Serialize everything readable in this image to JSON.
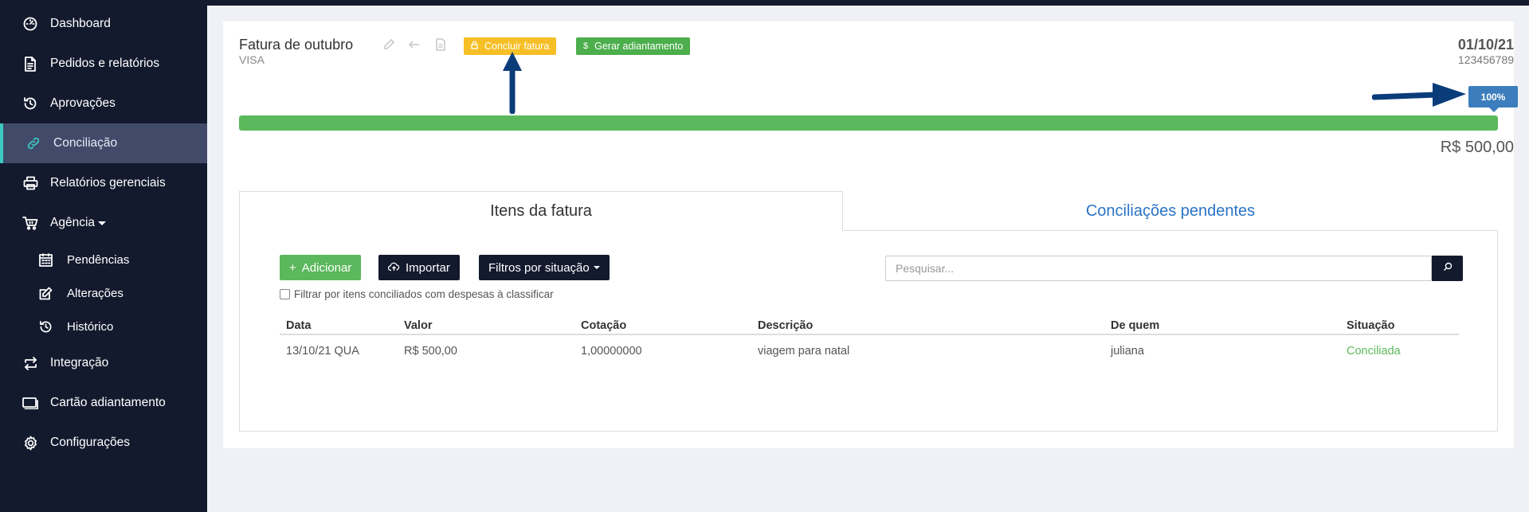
{
  "sidebar": {
    "items": [
      {
        "label": "Dashboard",
        "icon": "dashboard-icon"
      },
      {
        "label": "Pedidos e relatórios",
        "icon": "document-icon"
      },
      {
        "label": "Aprovações",
        "icon": "history-icon"
      },
      {
        "label": "Conciliação",
        "icon": "link-icon",
        "active": true
      },
      {
        "label": "Relatórios gerenciais",
        "icon": "printer-icon"
      },
      {
        "label": "Agência",
        "icon": "basket-icon"
      }
    ],
    "subitems": [
      {
        "label": "Pendências",
        "icon": "calendar-icon"
      },
      {
        "label": "Alterações",
        "icon": "edit-icon"
      },
      {
        "label": "Histórico",
        "icon": "history-icon"
      }
    ],
    "bottom_items": [
      {
        "label": "Integração",
        "icon": "sync-icon"
      },
      {
        "label": "Cartão adiantamento",
        "icon": "card-icon"
      },
      {
        "label": "Configurações",
        "icon": "gear-icon"
      }
    ]
  },
  "invoice": {
    "title": "Fatura de outubro",
    "card_brand": "VISA",
    "close_button": "Concluir fatura",
    "advance_button": "Gerar adiantamento",
    "date": "01/10/21",
    "number": "123456789",
    "progress_label": "100%",
    "progress_fraction": 1.0,
    "total": "R$ 500,00"
  },
  "tabs": {
    "items": "Itens da fatura",
    "pending": "Conciliações pendentes"
  },
  "toolbar": {
    "add": "Adicionar",
    "import": "Importar",
    "filter": "Filtros por situação",
    "search_placeholder": "Pesquisar...",
    "checkbox_label": "Filtrar por itens conciliados com despesas à classificar"
  },
  "table": {
    "headers": [
      "Data",
      "Valor",
      "Cotação",
      "Descrição",
      "De quem",
      "Situação"
    ],
    "rows": [
      [
        "13/10/21 QUA",
        "R$ 500,00",
        "1,00000000",
        "viagem para natal",
        "juliana",
        "Conciliada"
      ]
    ]
  },
  "colors": {
    "sidebar": "#131a2e",
    "accent_green": "#5cb85c",
    "accent_yellow": "#f6bf26",
    "accent_blue": "#3c7dbd",
    "annotation_arrow": "#0b3c7a"
  }
}
